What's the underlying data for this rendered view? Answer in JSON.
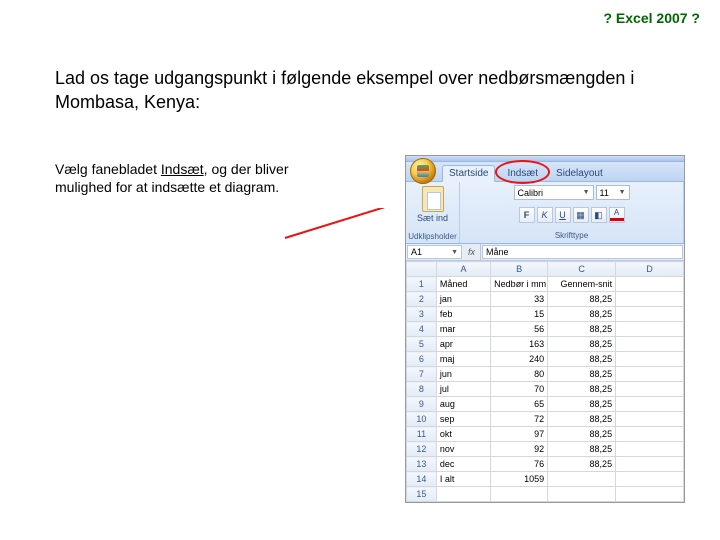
{
  "header": "? Excel 2007 ?",
  "intro": "Lad os tage udgangspunkt i følgende eksempel over nedbørsmængden i Mombasa, Kenya:",
  "instruction_pre": "Vælg fanebladet ",
  "instruction_link": "Indsæt",
  "instruction_post": ", og der bliver mulighed for at indsætte et diagram.",
  "ribbon": {
    "tabs": [
      "Startside",
      "Indsæt",
      "Sidelayout"
    ],
    "active_tab": "Startside",
    "circled_tab": "Indsæt",
    "paste_label": "Sæt ind",
    "clipboard_group": "Udklipsholder",
    "font_group": "Skrifttype",
    "font_name": "Calibri",
    "font_size": "11"
  },
  "formula": {
    "name_box": "A1",
    "value": "Måne"
  },
  "columns": [
    "A",
    "B",
    "C",
    "D"
  ],
  "header_row": [
    "Måned",
    "Nedbør i mm",
    "Gennem-snit"
  ],
  "data_rows": [
    {
      "n": 2,
      "a": "jan",
      "b": "33",
      "c": "88,25"
    },
    {
      "n": 3,
      "a": "feb",
      "b": "15",
      "c": "88,25"
    },
    {
      "n": 4,
      "a": "mar",
      "b": "56",
      "c": "88,25"
    },
    {
      "n": 5,
      "a": "apr",
      "b": "163",
      "c": "88,25"
    },
    {
      "n": 6,
      "a": "maj",
      "b": "240",
      "c": "88,25"
    },
    {
      "n": 7,
      "a": "jun",
      "b": "80",
      "c": "88,25"
    },
    {
      "n": 8,
      "a": "jul",
      "b": "70",
      "c": "88,25"
    },
    {
      "n": 9,
      "a": "aug",
      "b": "65",
      "c": "88,25"
    },
    {
      "n": 10,
      "a": "sep",
      "b": "72",
      "c": "88,25"
    },
    {
      "n": 11,
      "a": "okt",
      "b": "97",
      "c": "88,25"
    },
    {
      "n": 12,
      "a": "nov",
      "b": "92",
      "c": "88,25"
    },
    {
      "n": 13,
      "a": "dec",
      "b": "76",
      "c": "88,25"
    },
    {
      "n": 14,
      "a": "I alt",
      "b": "1059",
      "c": ""
    }
  ],
  "empty_rows": [
    15
  ]
}
